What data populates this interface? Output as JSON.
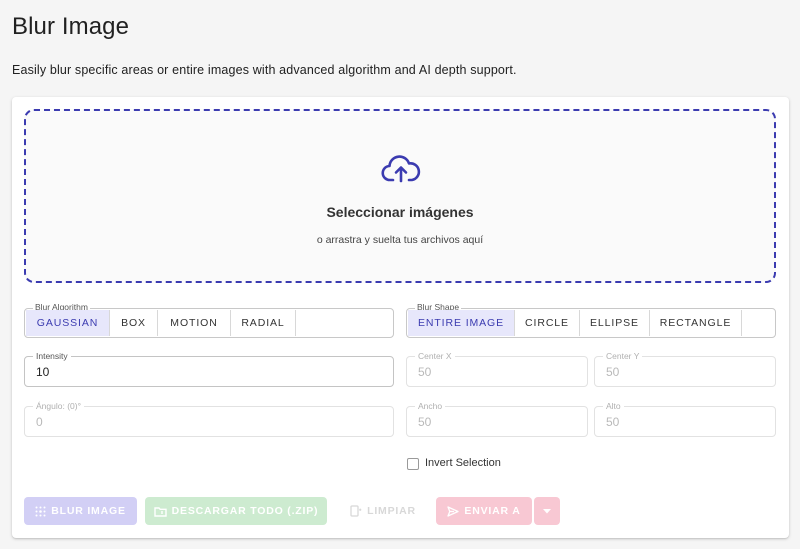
{
  "page": {
    "title": "Blur Image",
    "description": "Easily blur specific areas or entire images with advanced algorithm and AI depth support."
  },
  "dropzone": {
    "icon": "cloud-upload-icon",
    "title": "Seleccionar imágenes",
    "subtitle": "o arrastra y suelta tus archivos aquí"
  },
  "blur_algorithm": {
    "legend": "Blur Algorithm",
    "selected": "GAUSSIAN",
    "options": [
      "GAUSSIAN",
      "BOX",
      "MOTION",
      "RADIAL"
    ]
  },
  "blur_shape": {
    "legend": "Blur Shape",
    "selected": "ENTIRE IMAGE",
    "options": [
      "ENTIRE IMAGE",
      "CIRCLE",
      "ELLIPSE",
      "RECTANGLE"
    ]
  },
  "fields": {
    "intensity": {
      "label": "Intensity",
      "value": "10"
    },
    "center_x": {
      "label": "Center X",
      "value": "50"
    },
    "center_y": {
      "label": "Center Y",
      "value": "50"
    },
    "angle": {
      "label": "Ángulo: (0)°",
      "value": "0"
    },
    "width": {
      "label": "Ancho",
      "value": "50"
    },
    "height": {
      "label": "Alto",
      "value": "50"
    }
  },
  "invert_selection": {
    "label": "Invert Selection",
    "checked": false
  },
  "actions": {
    "blur": "BLUR IMAGE",
    "download_zip": "DESCARGAR TODO (.ZIP)",
    "clear": "LIMPIAR",
    "send": "ENVIAR A"
  },
  "colors": {
    "accent": "#3b3bb0",
    "blur_button": "#d2cff5",
    "zip_button": "#cdebd0",
    "send_button": "#f8c8d3"
  }
}
